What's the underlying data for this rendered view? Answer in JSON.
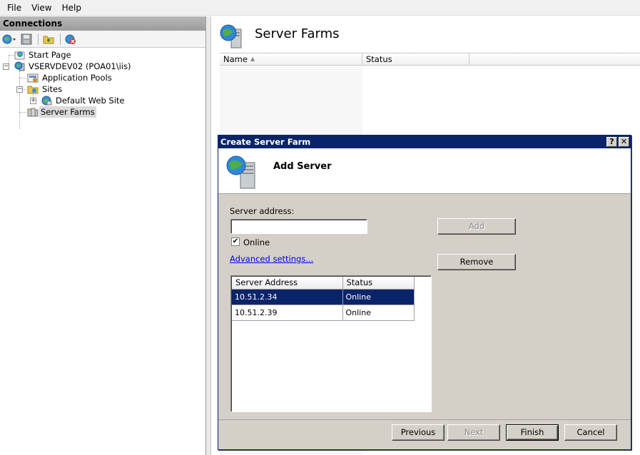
{
  "menu": [
    "File",
    "View",
    "Help"
  ],
  "connections": {
    "header": "Connections",
    "tree": {
      "start_page": "Start Page",
      "server": "VSERVDEV02 (POA01\\iis)",
      "app_pools": "Application Pools",
      "sites": "Sites",
      "default_site": "Default Web Site",
      "server_farms": "Server Farms"
    }
  },
  "main": {
    "title": "Server Farms",
    "columns": [
      "Name",
      "Status"
    ]
  },
  "dialog": {
    "title": "Create Server Farm",
    "help_btn": "?",
    "close_btn": "✕",
    "heading": "Add Server",
    "address_label": "Server address:",
    "address_value": "",
    "online_label": "Online",
    "online_checked": true,
    "advanced_link": "Advanced settings...",
    "add_btn": "Add",
    "remove_btn": "Remove",
    "list_columns": [
      "Server Address",
      "Status"
    ],
    "servers": [
      {
        "address": "10.51.2.34",
        "status": "Online"
      },
      {
        "address": "10.51.2.39",
        "status": "Online"
      }
    ],
    "buttons": {
      "previous": "Previous",
      "next": "Next",
      "finish": "Finish",
      "cancel": "Cancel"
    }
  },
  "colors": {
    "title_bar": "#0a246a",
    "selection": "#0a246a",
    "dialog_bg": "#d4d0c8"
  }
}
